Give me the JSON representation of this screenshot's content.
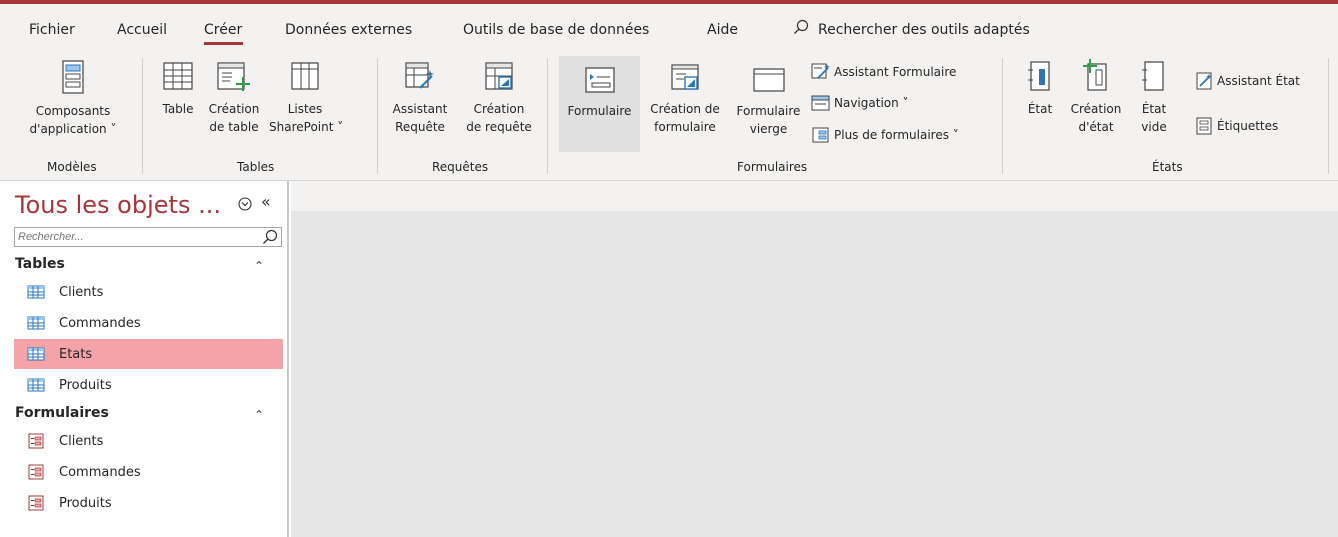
{
  "menu_tabs": [
    "Fichier",
    "Accueil",
    "Créer",
    "Données externes",
    "Outils de base de données",
    "Aide"
  ],
  "active_tab": "Créer",
  "search_label": "Rechercher des outils adaptés",
  "accent_color": "#a4373a",
  "ribbon": {
    "groups": {
      "modeles": "Modèles",
      "tables": "Tables",
      "requetes": "Requêtes",
      "formulaires": "Formulaires",
      "etats": "États"
    },
    "composants": [
      "Composants",
      "d'application ˅"
    ],
    "table": "Table",
    "creation_table": [
      "Création",
      "de table"
    ],
    "listes_sharepoint": [
      "Listes",
      "SharePoint ˅"
    ],
    "assistant_requete": [
      "Assistant",
      "Requête"
    ],
    "creation_requete": [
      "Création",
      "de requête"
    ],
    "formulaire": "Formulaire",
    "creation_formulaire": [
      "Création de",
      "formulaire"
    ],
    "formulaire_vierge": [
      "Formulaire",
      "vierge"
    ],
    "assistant_formulaire": "Assistant Formulaire",
    "navigation": "Navigation ˅",
    "plus_formulaires": "Plus de formulaires ˅",
    "etat": "État",
    "creation_etat": [
      "Création",
      "d'état"
    ],
    "etat_vide": [
      "État",
      "vide"
    ],
    "assistant_etat": "Assistant État",
    "etiquettes": "Étiquettes"
  },
  "nav_pane": {
    "title": "Tous les objets ...",
    "search_placeholder": "Rechercher...",
    "categories": [
      {
        "label": "Tables",
        "items": [
          "Clients",
          "Commandes",
          "Etats",
          "Produits"
        ]
      },
      {
        "label": "Formulaires",
        "items": [
          "Clients",
          "Commandes",
          "Produits"
        ]
      }
    ],
    "selected_item": "Etats"
  }
}
